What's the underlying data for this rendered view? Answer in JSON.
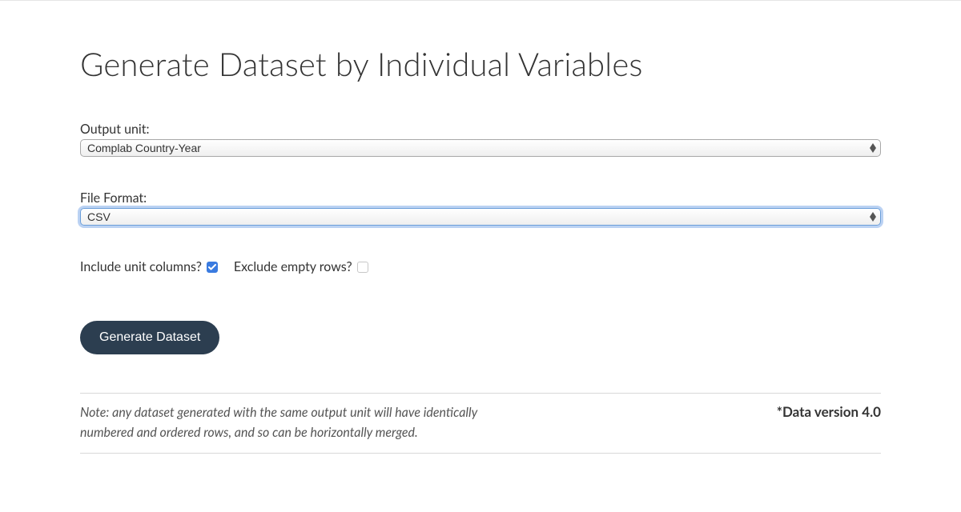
{
  "page": {
    "title": "Generate Dataset by Individual Variables"
  },
  "output_unit": {
    "label": "Output unit:",
    "value": "Complab Country-Year"
  },
  "file_format": {
    "label": "File Format:",
    "value": "CSV"
  },
  "checkboxes": {
    "include_unit_label": "Include unit columns?",
    "include_unit_checked": true,
    "exclude_empty_label": "Exclude empty rows?",
    "exclude_empty_checked": false
  },
  "button": {
    "generate_label": "Generate Dataset"
  },
  "footer": {
    "note": "Note: any dataset generated with the same output unit will have identically numbered and ordered rows, and so can be horizontally merged.",
    "version": "*Data version 4.0"
  }
}
